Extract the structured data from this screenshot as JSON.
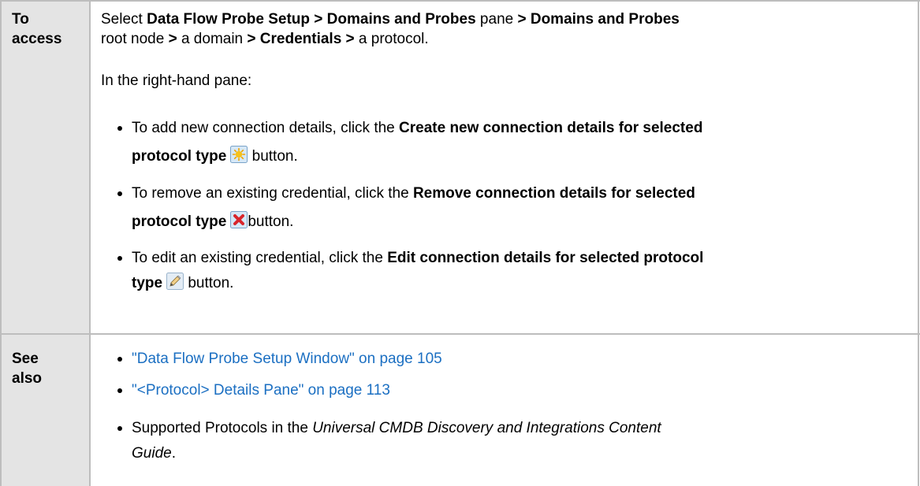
{
  "access": {
    "label_line1": "To",
    "label_line2": "access",
    "line1": {
      "p1": "Select ",
      "b1": "Data Flow Probe Setup > Domains and Probes",
      "p2": " pane ",
      "b2": "> Domains and Probes"
    },
    "line2": {
      "p1": "root node ",
      "b1": ">",
      "p2": " a domain ",
      "b2": "> Credentials >",
      "p3": " a protocol."
    },
    "right_pane": "In the right-hand pane:",
    "bullets": [
      {
        "l1_plain": "To add new connection details, click the ",
        "l1_bold": "Create new connection details for selected",
        "l2_bold": "protocol type",
        "l2_icon": "create-new-icon",
        "l2_plain": " button."
      },
      {
        "l1_plain": "To remove an existing credential, click the ",
        "l1_bold": "Remove connection details for selected",
        "l2_bold": "protocol type",
        "l2_icon": "remove-icon",
        "l2_plain": "button."
      },
      {
        "l1_plain": "To edit an existing credential, click the ",
        "l1_bold": "Edit connection details for selected protocol",
        "l2_bold": "type",
        "l2_icon": "edit-pencil-icon",
        "l2_plain": " button."
      }
    ]
  },
  "see_also": {
    "label_line1": "See",
    "label_line2": "also",
    "links": [
      "\"Data Flow Probe Setup Window\" on page 105",
      "\"<Protocol> Details Pane\" on page 113"
    ],
    "supported": {
      "p1": "Supported Protocols in the ",
      "i1": "Universal CMDB Discovery and Integrations Content",
      "i2": "Guide",
      "p2": "."
    }
  },
  "colors": {
    "border": "#bdbdbd",
    "label_bg": "#e4e4e4",
    "link": "#1b6fc2"
  }
}
